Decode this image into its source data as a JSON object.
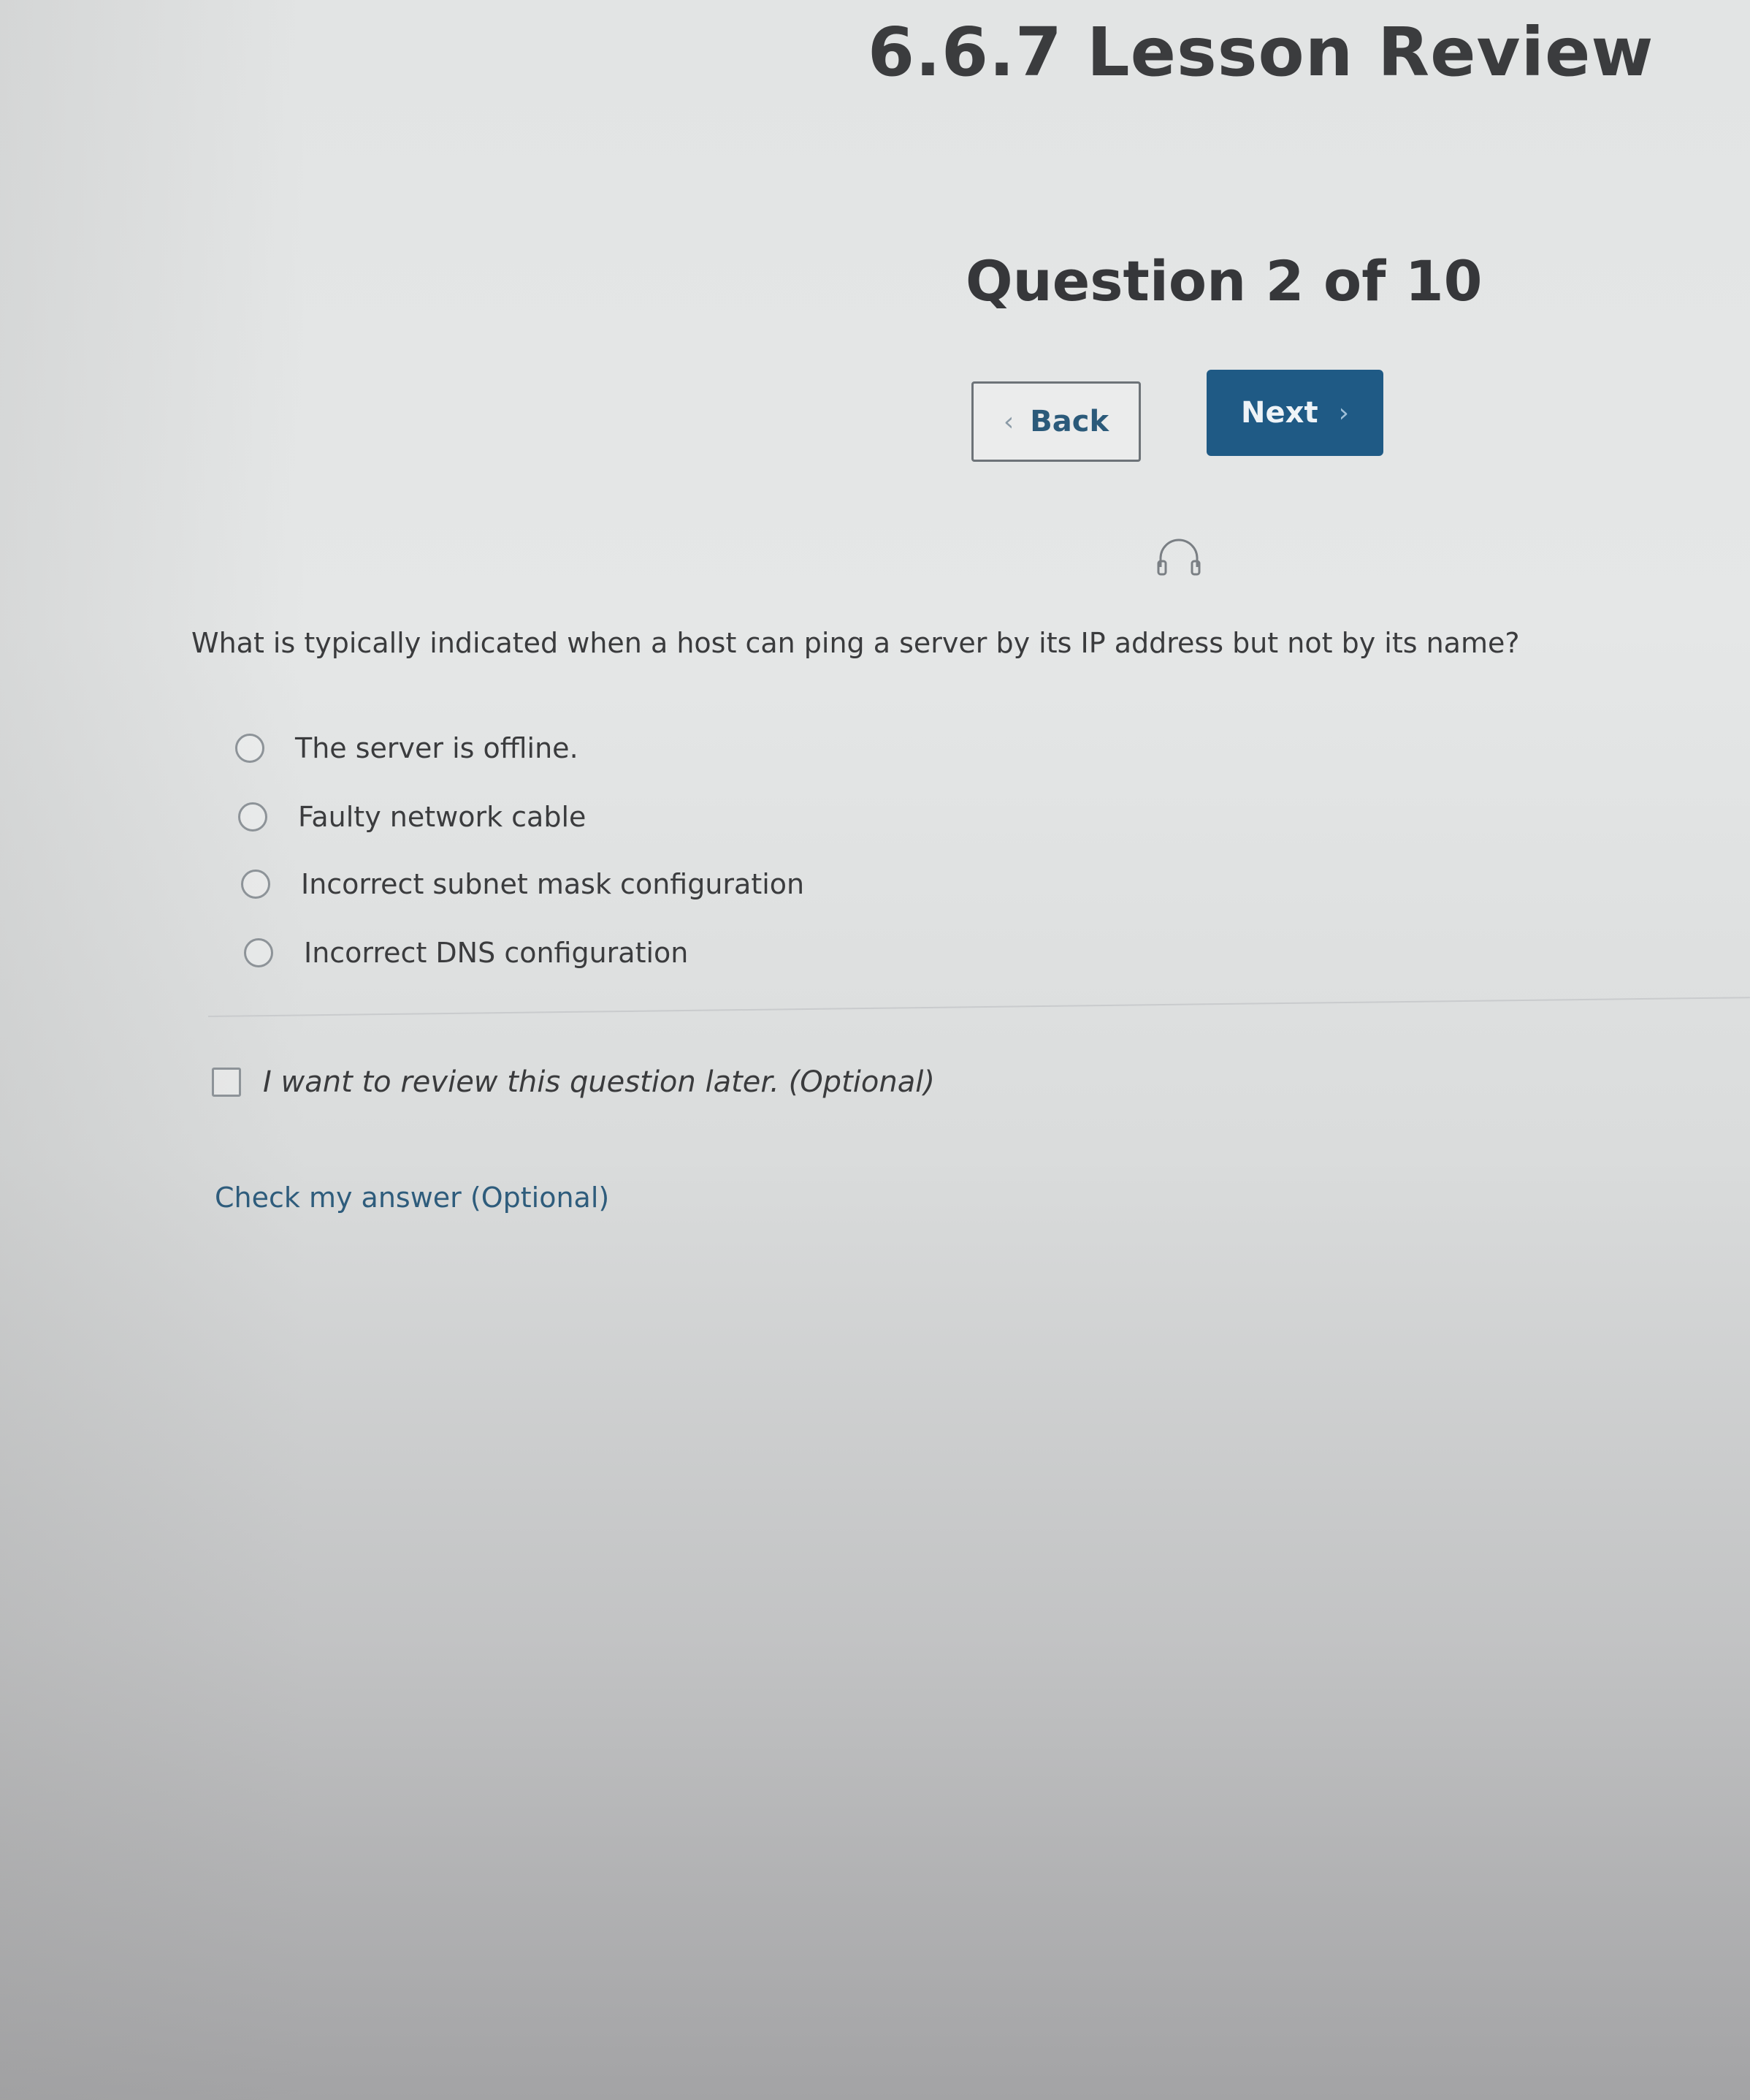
{
  "header": {
    "lesson_title": "6.6.7 Lesson Review",
    "question_counter": "Question 2 of 10"
  },
  "navigation": {
    "back_label": "Back",
    "next_label": "Next",
    "next_color": "#1f5a85"
  },
  "audio": {
    "icon": "headphones-icon"
  },
  "question": {
    "text": "What is typically indicated when a host can ping a server by its IP address but not by its name?",
    "options": [
      {
        "label": "The server is offline.",
        "selected": false
      },
      {
        "label": "Faulty network cable",
        "selected": false
      },
      {
        "label": "Incorrect subnet mask configuration",
        "selected": false
      },
      {
        "label": "Incorrect DNS configuration",
        "selected": false
      }
    ]
  },
  "review": {
    "label": "I want to review this question later. (Optional)",
    "checked": false
  },
  "check_answer": {
    "label": "Check my answer (Optional)"
  }
}
